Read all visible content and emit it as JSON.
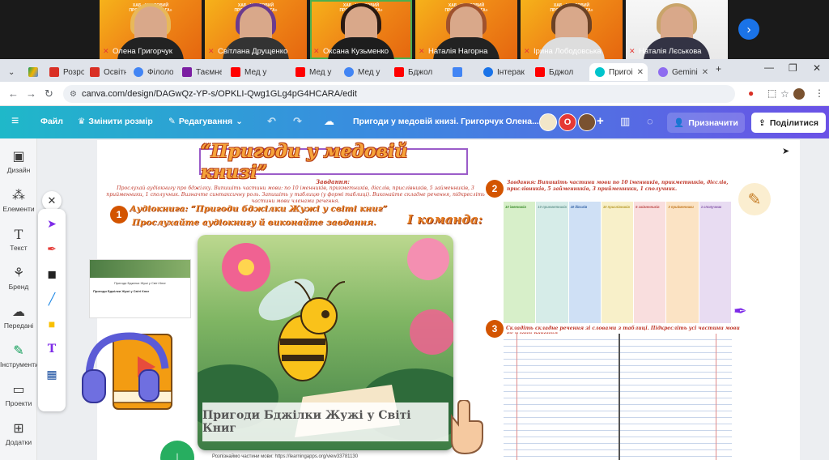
{
  "video_call": {
    "participants": [
      {
        "name": "Олена Григорчук",
        "hair": "#e8b85a",
        "shirt": "#222"
      },
      {
        "name": "Світлана Друщенко",
        "hair": "#6b3b8e",
        "shirt": "#333"
      },
      {
        "name": "Оксана Кузьменко",
        "hair": "#2a1a12",
        "shirt": "#1d1d1d"
      },
      {
        "name": "Наталія Нагорна",
        "hair": "#a0522d",
        "shirt": "#222"
      },
      {
        "name": "Ірина Лободовська",
        "hair": "#6b4226",
        "shirt": "#ddd"
      },
      {
        "name": "Наталія Лєськова",
        "hair": "#c9a46a",
        "shirt": "#334"
      }
    ],
    "bg_text": "ХАБ «ЦИФРОВИЙ ПРОСТІР ПЕДАГОГА»",
    "next_icon": "chevron-right-icon"
  },
  "browser": {
    "tabs": [
      {
        "label": "Розроб",
        "color": "#d93025"
      },
      {
        "label": "Освітн",
        "color": "#d93025"
      },
      {
        "label": "Філоло",
        "color": "#4285f4"
      },
      {
        "label": "Таємне",
        "color": "#7b1fa2"
      },
      {
        "label": "Мед у ",
        "color": "#ff0000"
      },
      {
        "label": "Мед у ",
        "color": "#4285f4"
      },
      {
        "label": "Бджол",
        "color": "#ff0000"
      },
      {
        "label": "Інтерак",
        "color": "#1a73e8"
      },
      {
        "label": "Бджол",
        "color": "#ff0000"
      },
      {
        "label": "Пригоі",
        "color": "#00c4cc"
      },
      {
        "label": "Gemini",
        "color": "#8e6cf0"
      }
    ],
    "url": "canva.com/design/DAGwQz-YP-s/OPKLI-Qwg1GLg4pG4HCARA/edit"
  },
  "canva_header": {
    "file": "Файл",
    "resize": "Змінити розмір",
    "editing": "Редагування",
    "doc_title": "Пригоди у медовій книзі. Григорчук Олена...",
    "avatar_letter": "О",
    "assign": "Призначити",
    "share": "Поділитися"
  },
  "rail": [
    {
      "label": "Дизайн",
      "icon": "layout-icon"
    },
    {
      "label": "Елементи",
      "icon": "shapes-icon"
    },
    {
      "label": "Текст",
      "icon": "text-icon"
    },
    {
      "label": "Бренд",
      "icon": "brand-icon"
    },
    {
      "label": "Передані",
      "icon": "upload-icon"
    },
    {
      "label": "Інструменти",
      "icon": "draw-icon"
    },
    {
      "label": "Проекти",
      "icon": "folder-icon"
    },
    {
      "label": "Додатки",
      "icon": "apps-icon"
    }
  ],
  "board": {
    "title": "“Пригоди у медовій книзі”",
    "task_heading": "Завдання:",
    "task_text": "Прослухай аудіокнигу про бджілку. Випишіть частини мови: по 10 іменників, прикметників, дієслів, прислівників, 5 займенників, 3 прийменники, 1 сполучник. Визначте синтаксичну роль. Запишіть у таблицю (у формі таблиці). Виконайте складне речення, підкресліть частини мови членами речення.",
    "step1_title": "Аудіокнига: “Пригоди бджілки Жужі у світі книг”",
    "step1_sub": "Прослухайте аудіокнигу й виконайте завдання.",
    "team": "І команда:",
    "step2_text": "Завдання: Випишіть частини мови по 10 іменників, прикметників, дієслів, прислівників, 5 займенників, 3 прийменники, 1 сполучник.",
    "table_headers": [
      "10 іменників",
      "10 прикметників",
      "10 дієслів",
      "10 прислівників",
      "5 займенників",
      "3 прийменники",
      "1 сполучник"
    ],
    "table_colors": [
      "#d7efc9",
      "#d6ece8",
      "#cfe0f5",
      "#f8f0c9",
      "#f9dede",
      "#fbe3c4",
      "#e8dcf2"
    ],
    "header_colors": [
      "#3f8f2f",
      "#6a9a93",
      "#2f5fa3",
      "#b89b2b",
      "#c05050",
      "#c47a22",
      "#8455a8"
    ],
    "step3_text": "Складіть складне речення зі словами з таблиці. Підкресліть усі частини мови як члени речення.",
    "image_caption": "Пригоди Бджілки Жужі у Світі Книг",
    "thumb_title": "Пригоди Бджілки Жужі у Світі Книг",
    "thumb_line": "Пригоди Бджілки Жужі у Світі Книг",
    "bottom_text": "Розпізнаймо частини мови: https://learningapps.org/view33781130"
  }
}
